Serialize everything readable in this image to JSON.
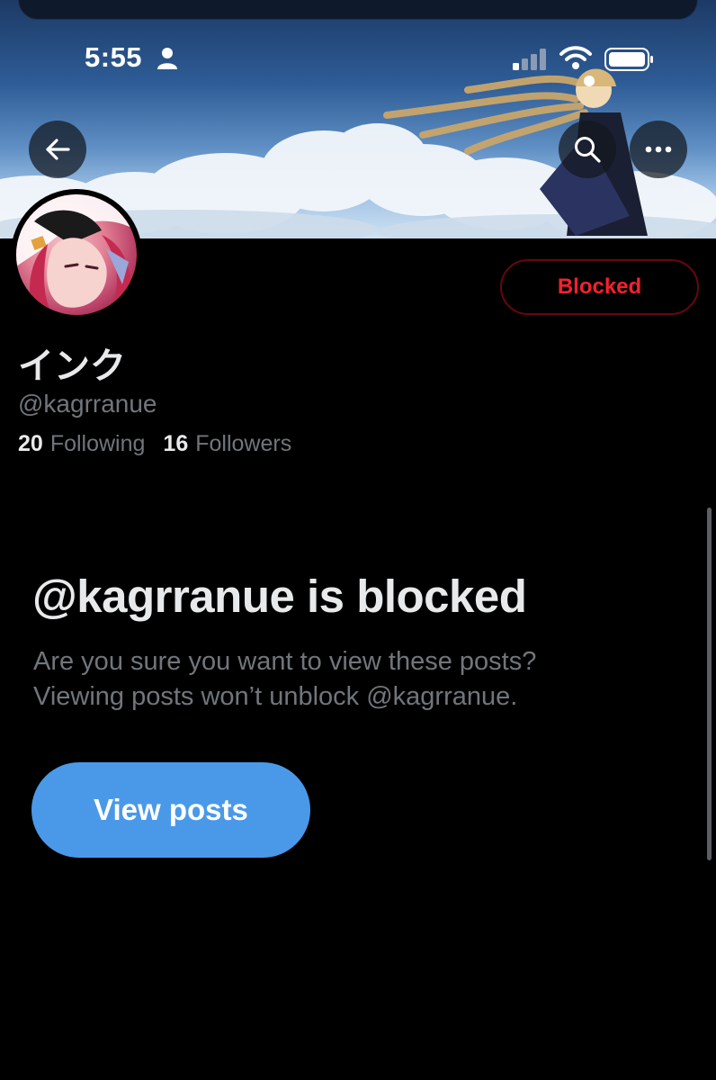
{
  "status_bar": {
    "time": "5:55"
  },
  "icons": {
    "back": "arrow-left-icon",
    "search": "search-icon",
    "more": "more-horizontal-icon",
    "person": "person-icon",
    "signal": "cellular-signal-icon",
    "wifi": "wifi-icon",
    "battery": "battery-icon"
  },
  "profile": {
    "display_name": "インク",
    "handle": "@kagrranue",
    "following_count": "20",
    "following_label": "Following",
    "followers_count": "16",
    "followers_label": "Followers",
    "blocked_button_label": "Blocked"
  },
  "blocked_notice": {
    "title": "@kagrranue is blocked",
    "line1": "Are you sure you want to view these posts?",
    "line2": "Viewing posts won’t unblock @kagrranue.",
    "view_posts_label": "View posts"
  },
  "colors": {
    "background": "#000000",
    "blocked_red": "#f4212e",
    "blocked_border": "#67070f",
    "primary_button": "#4a99e9",
    "secondary_text": "#71767b"
  }
}
